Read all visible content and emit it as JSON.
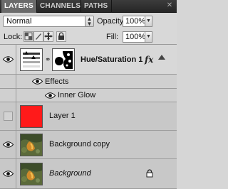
{
  "tabs": [
    {
      "label": "LAYERS",
      "active": true
    },
    {
      "label": "CHANNELS",
      "active": false
    },
    {
      "label": "PATHS",
      "active": false
    }
  ],
  "tabs_close_icon": "panel-close-icon",
  "blend_mode": {
    "value": "Normal"
  },
  "opacity": {
    "label": "Opacity:",
    "value": "100%"
  },
  "lock": {
    "label": "Lock:",
    "buttons": [
      "lock-transparent-icon",
      "lock-paint-icon",
      "lock-position-icon",
      "lock-all-icon"
    ]
  },
  "fill": {
    "label": "Fill:",
    "value": "100%"
  },
  "layers": [
    {
      "name": "Hue/Saturation 1",
      "visible": true,
      "type": "adjustment",
      "has_fx": true,
      "fx_label": "fx",
      "selected": true
    },
    {
      "name": "Effects",
      "visible": true,
      "type": "effects-group"
    },
    {
      "name": "Inner Glow",
      "visible": true,
      "type": "effect"
    },
    {
      "name": "Layer 1",
      "visible": false,
      "type": "fill",
      "color": "#ff1a1a"
    },
    {
      "name": "Background copy",
      "visible": true,
      "type": "image"
    },
    {
      "name": "Background",
      "visible": true,
      "type": "image",
      "locked": true
    }
  ],
  "colors": {
    "tab_bar": "#2e2e2e",
    "active_tab": "#6b6b6b",
    "panel": "#d6d6d6",
    "selected_row": "#d8d8d8",
    "layer1_fill": "#ff1a1a"
  }
}
